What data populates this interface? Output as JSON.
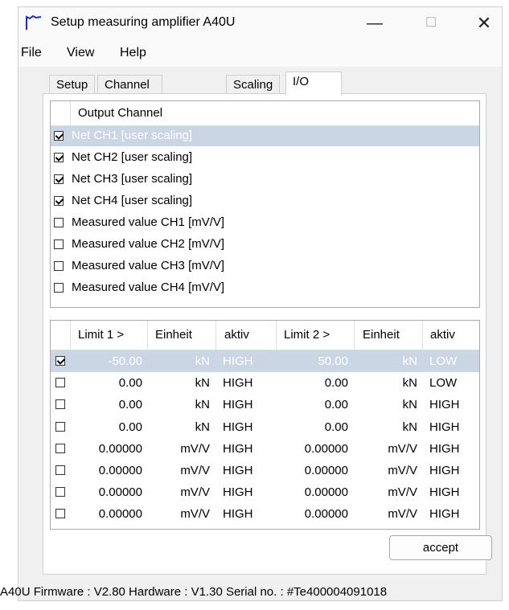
{
  "window": {
    "title": "Setup measuring amplifier A40U",
    "min": "—",
    "max": "☐",
    "close": "✕"
  },
  "menu": [
    "File",
    "View",
    "Help"
  ],
  "tabs": [
    "Setup",
    "Channel activation",
    "Scaling",
    "I/O"
  ],
  "output_channel": {
    "header": "Output Channel",
    "items": [
      {
        "label": "Net CH1 [user scaling]",
        "checked": true,
        "selected": true
      },
      {
        "label": "Net CH2 [user scaling]",
        "checked": true,
        "selected": false
      },
      {
        "label": "Net CH3 [user scaling]",
        "checked": true,
        "selected": false
      },
      {
        "label": "Net CH4 [user scaling]",
        "checked": true,
        "selected": false
      },
      {
        "label": "Measured value CH1 [mV/V]",
        "checked": false,
        "selected": false
      },
      {
        "label": "Measured value CH2 [mV/V]",
        "checked": false,
        "selected": false
      },
      {
        "label": "Measured value CH3 [mV/V]",
        "checked": false,
        "selected": false
      },
      {
        "label": "Measured value CH4 [mV/V]",
        "checked": false,
        "selected": false
      }
    ]
  },
  "limits": {
    "headers": [
      "Limit 1 >",
      "Einheit",
      "aktiv",
      "Limit 2 >",
      "Einheit",
      "aktiv"
    ],
    "rows": [
      {
        "checked": true,
        "selected": true,
        "limit1": "-50.00",
        "unit1": "kN",
        "aktiv1": "HIGH",
        "limit2": "50.00",
        "unit2": "kN",
        "aktiv2": "LOW"
      },
      {
        "checked": false,
        "selected": false,
        "limit1": "0.00",
        "unit1": "kN",
        "aktiv1": "HIGH",
        "limit2": "0.00",
        "unit2": "kN",
        "aktiv2": "LOW"
      },
      {
        "checked": false,
        "selected": false,
        "limit1": "0.00",
        "unit1": "kN",
        "aktiv1": "HIGH",
        "limit2": "0.00",
        "unit2": "kN",
        "aktiv2": "HIGH"
      },
      {
        "checked": false,
        "selected": false,
        "limit1": "0.00",
        "unit1": "kN",
        "aktiv1": "HIGH",
        "limit2": "0.00",
        "unit2": "kN",
        "aktiv2": "HIGH"
      },
      {
        "checked": false,
        "selected": false,
        "limit1": "0.00000",
        "unit1": "mV/V",
        "aktiv1": "HIGH",
        "limit2": "0.00000",
        "unit2": "mV/V",
        "aktiv2": "HIGH"
      },
      {
        "checked": false,
        "selected": false,
        "limit1": "0.00000",
        "unit1": "mV/V",
        "aktiv1": "HIGH",
        "limit2": "0.00000",
        "unit2": "mV/V",
        "aktiv2": "HIGH"
      },
      {
        "checked": false,
        "selected": false,
        "limit1": "0.00000",
        "unit1": "mV/V",
        "aktiv1": "HIGH",
        "limit2": "0.00000",
        "unit2": "mV/V",
        "aktiv2": "HIGH"
      },
      {
        "checked": false,
        "selected": false,
        "limit1": "0.00000",
        "unit1": "mV/V",
        "aktiv1": "HIGH",
        "limit2": "0.00000",
        "unit2": "mV/V",
        "aktiv2": "HIGH"
      }
    ]
  },
  "accept_label": "accept",
  "status": "A40U  Firmware : V2.80  Hardware : V1.30  Serial no. : #Te400004091018",
  "colors": {
    "selection": "#cad6e4",
    "app_icon": "#1a2bd6"
  }
}
